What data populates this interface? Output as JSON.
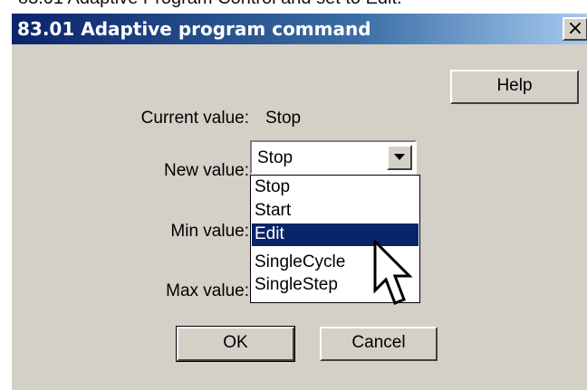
{
  "background_caption": "83.01 Adaptive Program Control and set to Edit.",
  "dialog": {
    "title": "83.01 Adaptive program command",
    "close_symbol": "×",
    "help_label": "Help",
    "current_value_label": "Current value:",
    "current_value": "Stop",
    "new_value_label": "New value:",
    "new_value_selected": "Stop",
    "min_value_label": "Min value:",
    "max_value_label": "Max value:",
    "ok_label": "OK",
    "cancel_label": "Cancel"
  },
  "dropdown": {
    "options": [
      "Stop",
      "Start",
      "Edit",
      "SingleCycle",
      "SingleStep"
    ],
    "highlighted": "Edit"
  },
  "colors": {
    "dialog_face": "#d4d0c8",
    "title_gradient_start": "#0a246a",
    "title_gradient_end": "#a6caf0",
    "selection": "#0a246a"
  },
  "icons": {
    "close": "close-icon",
    "combo_arrow": "chevron-down-icon",
    "cursor": "mouse-pointer-icon"
  }
}
